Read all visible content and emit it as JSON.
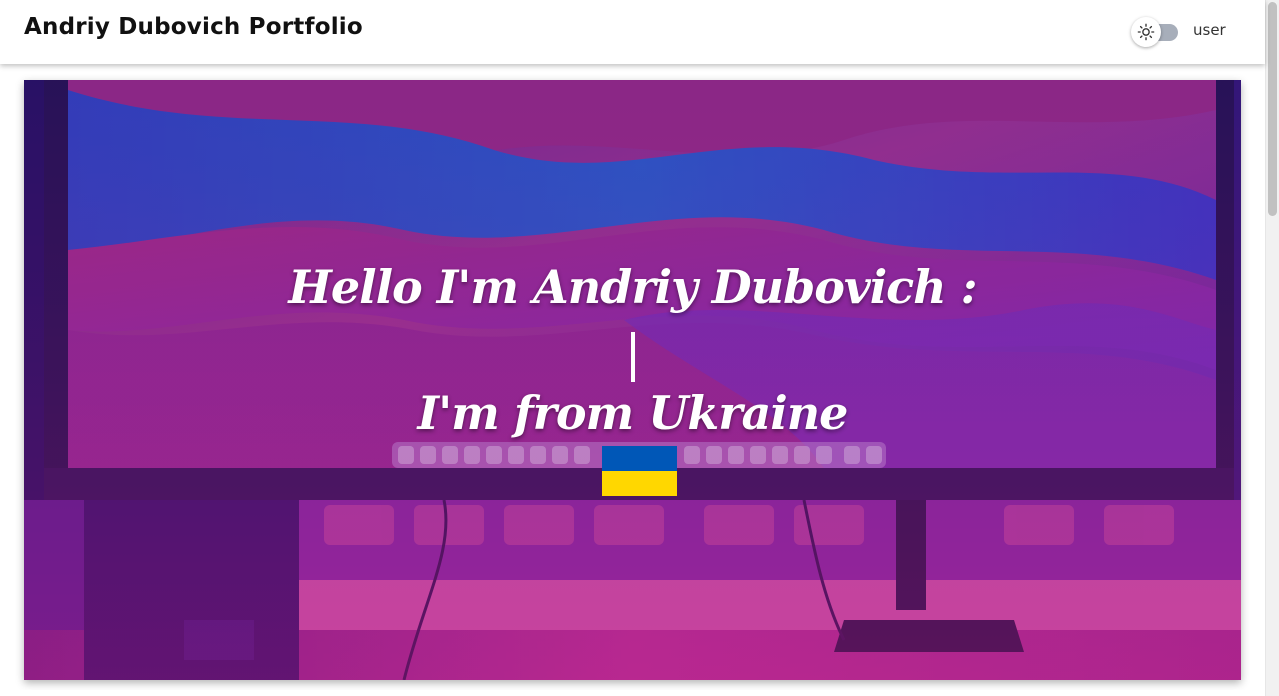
{
  "header": {
    "title": "Andriy Dubovich Portfolio",
    "theme_toggle_icon": "sun-icon",
    "user_label": "user"
  },
  "hero": {
    "greeting": "Hello I'm Andriy Dubovich :",
    "cursor": "|",
    "origin": "I'm from Ukraine",
    "flag": {
      "top_color": "#0057b7",
      "bottom_color": "#ffd700"
    }
  },
  "colors": {
    "overlay_purple": "#5a1fb0",
    "overlay_magenta": "#c81e8c",
    "header_bg": "#ffffff"
  }
}
